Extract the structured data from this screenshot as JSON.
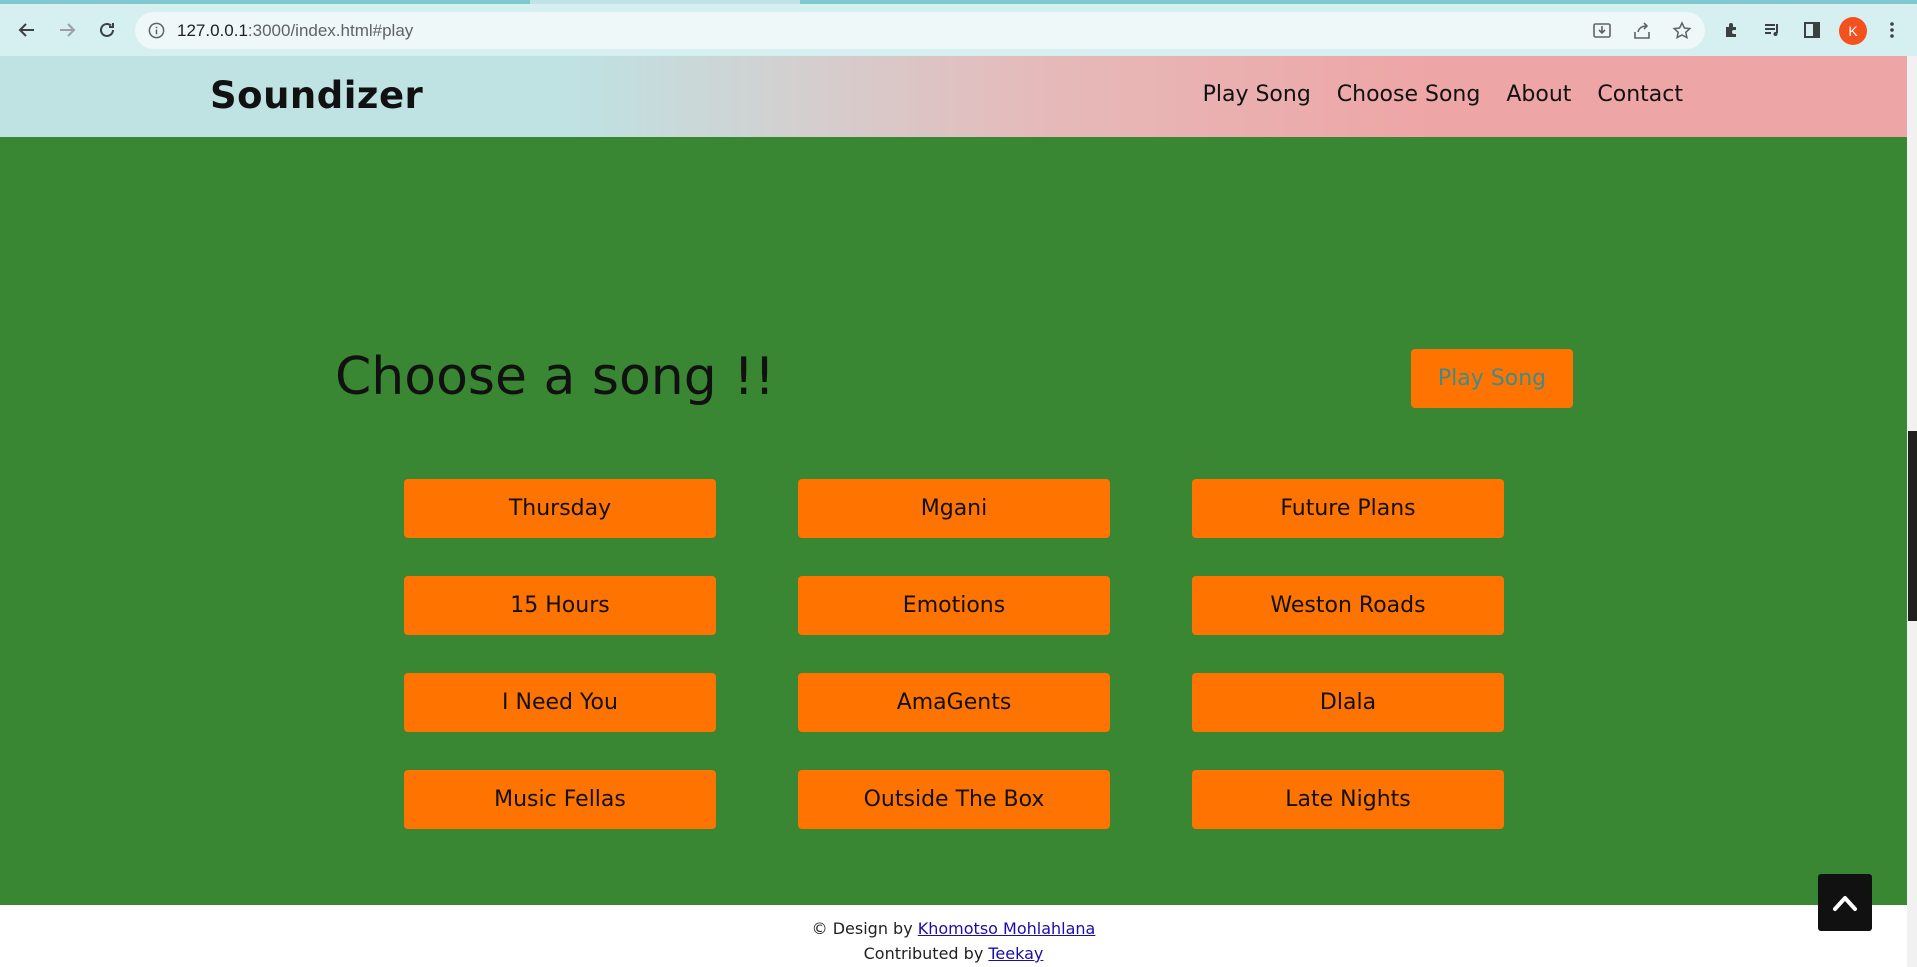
{
  "browser": {
    "url_host": "127.0.0.1",
    "url_rest": ":3000/index.html#play",
    "profile_initial": "K",
    "icons": [
      "back-icon",
      "forward-icon",
      "reload-icon",
      "site-info-icon",
      "install-icon",
      "share-icon",
      "bookmark-star-icon",
      "extensions-icon",
      "media-icon",
      "side-panel-icon",
      "menu-dots-icon"
    ]
  },
  "navbar": {
    "brand": "Soundizer",
    "links": [
      "Play Song",
      "Choose Song",
      "About",
      "Contact"
    ]
  },
  "main": {
    "heading": "Choose a song !!",
    "play_button": "Play Song",
    "songs": [
      "Thursday",
      "Mgani",
      "Future Plans",
      "15 Hours",
      "Emotions",
      "Weston Roads",
      "I Need You",
      "AmaGents",
      "Dlala",
      "Music Fellas",
      "Outside The Box",
      "Late Nights"
    ]
  },
  "footer": {
    "design_prefix": "© Design by ",
    "designer": "Khomotso Mohlahlana",
    "contrib_prefix": "Contributed by ",
    "contributor": "Teekay"
  },
  "colors": {
    "main_bg": "#398732",
    "button_orange": "#ff7300",
    "nav_gradient_left": "#bfe2e3",
    "nav_gradient_right": "#eea5a6"
  }
}
